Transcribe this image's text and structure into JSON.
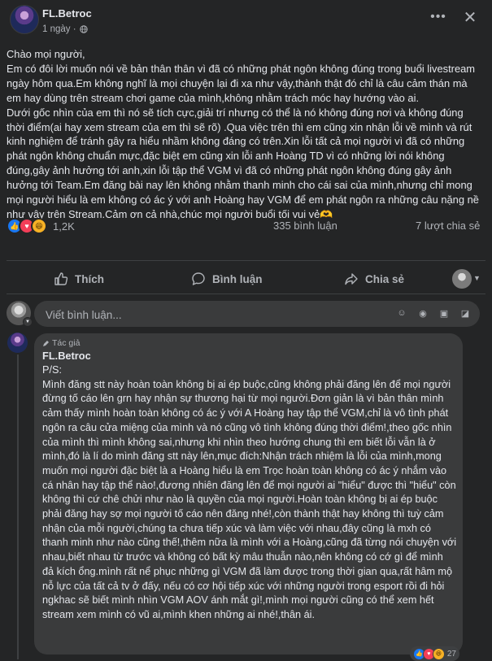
{
  "post": {
    "author": "FL.Betroc",
    "time": "1 ngày ·",
    "paragraphs": [
      "Chào mọi người,",
      "Em có đôi lời muốn nói về bản thân thân vì đã có những phát ngôn không đúng trong buổi livestream ngày hôm qua.Em không nghĩ là mọi chuyện lại đi xa như vậy,thành thật đó chỉ là câu cảm thán mà em hay dùng trên stream chơi game của mình,không nhằm trách móc hay hướng vào ai.",
      "Dưới gốc nhìn của em thì nó sẽ tích cực,giải trí nhưng có thể là nó không đúng nơi và không đúng thời điểm(ai hay xem stream của em thì sẽ rõ) .Qua việc trên thì em cũng xin nhận lỗi về mình và rút kinh nghiệm để tránh gây ra hiểu nhầm không đáng có trên.Xin lỗi tất cả mọi người vì đã có những phát ngôn không chuẩn mực,đặc biệt em cũng xin lỗi anh Hoàng TD vì có những lời nói không đúng,gây ảnh hưởng tới anh,xin lỗi tập thể VGM vì đã có những phát ngôn không đúng gây ảnh hưởng tới Team.Em đăng bài nay lên không nhằm thanh minh cho cái sai của mình,nhưng chỉ mong mọi người hiểu là em không có ác ý với anh Hoàng hay VGM để em phát ngôn ra những câu nặng nề như vậy trên Stream.Cảm ơn cả nhà,chúc mọi người buổi tối vui vẻ🫶"
    ],
    "reaction_count": "1,2K",
    "comment_count": "335 bình luận",
    "share_count": "7 lượt chia sẻ"
  },
  "actions": {
    "like": "Thích",
    "comment": "Bình luận",
    "share": "Chia sẻ"
  },
  "comment_box": {
    "placeholder": "Viết bình luận...",
    "icons": [
      "smiley-icon",
      "camera-icon",
      "gif-icon",
      "sticker-icon"
    ]
  },
  "reply": {
    "badge": "Tác giả",
    "author": "FL.Betroc",
    "paragraphs": [
      "P/S:",
      "Mình đăng stt này hoàn toàn không bị ai ép buộc,cũng không phải đăng lên để mọi người đừng tố cáo lên grn hay nhận sự thương hại từ mọi người.Đơn giản là vì bản thân mình cảm thấy mình hoàn toàn không có ác ý với A Hoàng hay tập thể VGM,chỉ là vô tình phát ngôn ra câu cửa miệng của mình và nó cũng vô tình không đúng thời điểm!,theo gốc nhìn của mình thì mình không sai,nhưng khi nhìn theo hướng chung thì em biết lỗi vẫn là ở mình,đó là lí do mình đăng stt này lên,mục đích:Nhận trách nhiệm là lỗi của mình,mong muốn mọi người đặc biệt là a Hoàng hiểu là em Trọc hoàn toàn không có ác ý nhắm vào cá nhân hay tập thể nào!,đương nhiên đăng lên để mọi người ai \"hiểu\" được thì \"hiểu\" còn không thì cứ chê chửi như nào là quyền của mọi người.Hoàn toàn không bị ai ép buộc phải đăng hay sợ mọi người tố cáo nên đăng nhé!,còn thành thật hay không thì tuỳ cảm nhận của mỗi người,chúng ta chưa tiếp xúc và làm việc với nhau,đây cũng là mxh có thanh minh như nào cũng thế!,thêm nữa là mình với a Hoàng,cũng đã từng nói chuyện với nhau,biết nhau từ trước và không có bất kỳ mâu thuẫn nào,nên không có cớ gì để mình đả kích ổng.mình rất nể phục những gì VGM đã làm được trong thời gian qua,rất hâm mộ nỗ lực của tất cả tv ở đấy, nếu có cơ hội tiếp xúc với những người trong esport rồi đi hỏi ngkhac sẽ biết mình nhìn VGM AOV ánh mắt gì!,mình mọi người cũng có thể xem hết stream xem mình có vũ ai,mình khen những ai nhé!,thân ái."
    ],
    "reaction_count": "27"
  },
  "colors": {
    "background": "#242526",
    "bubble": "#3a3b3c",
    "text": "#e4e6eb",
    "muted": "#b0b3b8",
    "like_blue": "#1877f2",
    "love_red": "#f33e58",
    "haha_yellow": "#f7b125"
  }
}
